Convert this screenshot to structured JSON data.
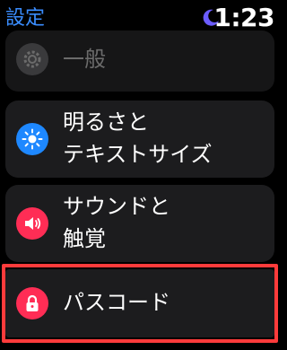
{
  "status_bar": {
    "back_title": "設定",
    "moon_icon": "moon-icon",
    "time": "1:23"
  },
  "rows": [
    {
      "label": "一般",
      "icon": "gear-icon",
      "icon_color": "#4a4a4a",
      "dimmed": true
    },
    {
      "label_line1": "明るさと",
      "label_line2": "テキストサイズ",
      "icon": "sun-icon",
      "icon_color": "#1e88ff"
    },
    {
      "label_line1": "サウンドと",
      "label_line2": "触覚",
      "icon": "speaker-icon",
      "icon_color": "#ff2d55"
    },
    {
      "label": "パスコード",
      "icon": "lock-icon",
      "icon_color": "#ff2d55",
      "highlighted": true
    }
  ],
  "colors": {
    "accent": "#3a8dff",
    "moon": "#6b5cff",
    "highlight": "#ff3b3b"
  }
}
